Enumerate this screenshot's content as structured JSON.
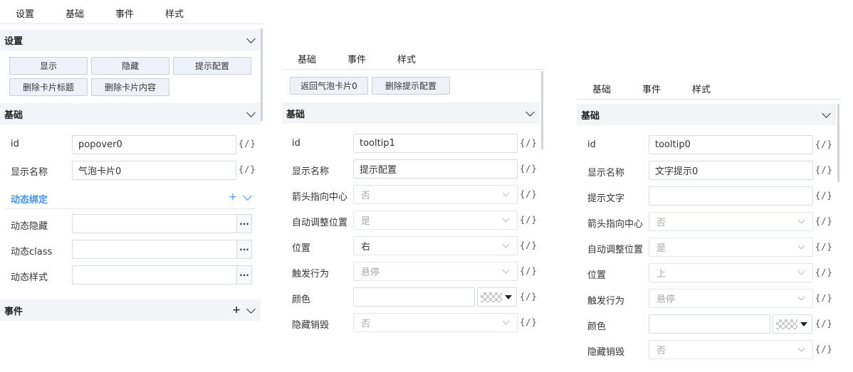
{
  "panel1": {
    "tabs": [
      "设置",
      "基础",
      "事件",
      "样式"
    ],
    "settings_title": "设置",
    "buttons": [
      "显示",
      "隐藏",
      "提示配置",
      "删除卡片标题",
      "删除卡片内容"
    ],
    "basic_title": "基础",
    "fields": [
      {
        "label": "id",
        "value": "popover0"
      },
      {
        "label": "显示名称",
        "value": "气泡卡片0"
      }
    ],
    "dynamic_title": "动态绑定",
    "dynamic_plus": "+",
    "dynamic_fields": [
      {
        "label": "动态隐藏",
        "value": ""
      },
      {
        "label": "动态class",
        "value": ""
      },
      {
        "label": "动态样式",
        "value": ""
      }
    ],
    "events_title": "事件",
    "events_plus": "+",
    "fx": "{/}",
    "dots": "···"
  },
  "panel2": {
    "tabs": [
      "基础",
      "事件",
      "样式"
    ],
    "buttons": [
      "返回气泡卡片0",
      "删除提示配置"
    ],
    "basic_title": "基础",
    "fields": [
      {
        "label": "id",
        "value": "tooltip1",
        "type": "input"
      },
      {
        "label": "显示名称",
        "value": "提示配置",
        "type": "input"
      },
      {
        "label": "箭头指向中心",
        "value": "否",
        "type": "select"
      },
      {
        "label": "自动调整位置",
        "value": "是",
        "type": "select"
      },
      {
        "label": "位置",
        "value": "右",
        "type": "select-dark"
      },
      {
        "label": "触发行为",
        "value": "悬停",
        "type": "select"
      },
      {
        "label": "颜色",
        "value": "",
        "type": "color"
      },
      {
        "label": "隐藏销毁",
        "value": "否",
        "type": "select"
      }
    ],
    "fx": "{/}"
  },
  "panel3": {
    "tabs": [
      "基础",
      "事件",
      "样式"
    ],
    "basic_title": "基础",
    "fields": [
      {
        "label": "id",
        "value": "tooltip0",
        "type": "input"
      },
      {
        "label": "显示名称",
        "value": "文字提示0",
        "type": "input"
      },
      {
        "label": "提示文字",
        "value": "",
        "type": "input"
      },
      {
        "label": "箭头指向中心",
        "value": "否",
        "type": "select"
      },
      {
        "label": "自动调整位置",
        "value": "是",
        "type": "select"
      },
      {
        "label": "位置",
        "value": "上",
        "type": "select"
      },
      {
        "label": "触发行为",
        "value": "悬停",
        "type": "select"
      },
      {
        "label": "颜色",
        "value": "",
        "type": "color"
      },
      {
        "label": "隐藏销毁",
        "value": "否",
        "type": "select"
      }
    ],
    "fx": "{/}"
  }
}
